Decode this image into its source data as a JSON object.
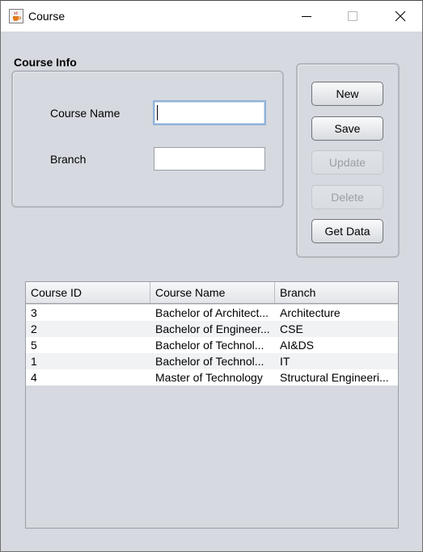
{
  "window": {
    "title": "Course",
    "icon": "java-cup-icon"
  },
  "controls": {
    "minimize": "minimize-icon",
    "maximize": "maximize-icon",
    "close": "close-icon"
  },
  "course_info": {
    "title": "Course Info",
    "course_name_label": "Course Name",
    "branch_label": "Branch",
    "course_name_value": "",
    "branch_value": ""
  },
  "buttons": {
    "new": "New",
    "save": "Save",
    "update": "Update",
    "delete": "Delete",
    "get_data": "Get Data"
  },
  "table": {
    "headers": [
      "Course ID",
      "Course Name",
      "Branch"
    ],
    "rows": [
      [
        "3",
        "Bachelor of Architect...",
        "Architecture"
      ],
      [
        "2",
        "Bachelor of Engineer...",
        "CSE"
      ],
      [
        "5",
        "Bachelor of Technol...",
        "AI&DS"
      ],
      [
        "1",
        "Bachelor of Technol...",
        "IT"
      ],
      [
        "4",
        "Master of Technology",
        "Structural Engineeri..."
      ]
    ]
  },
  "colors": {
    "background": "#d6d9df",
    "focus_border": "#8fb3d9",
    "disabled_text": "#9aa0a6"
  }
}
